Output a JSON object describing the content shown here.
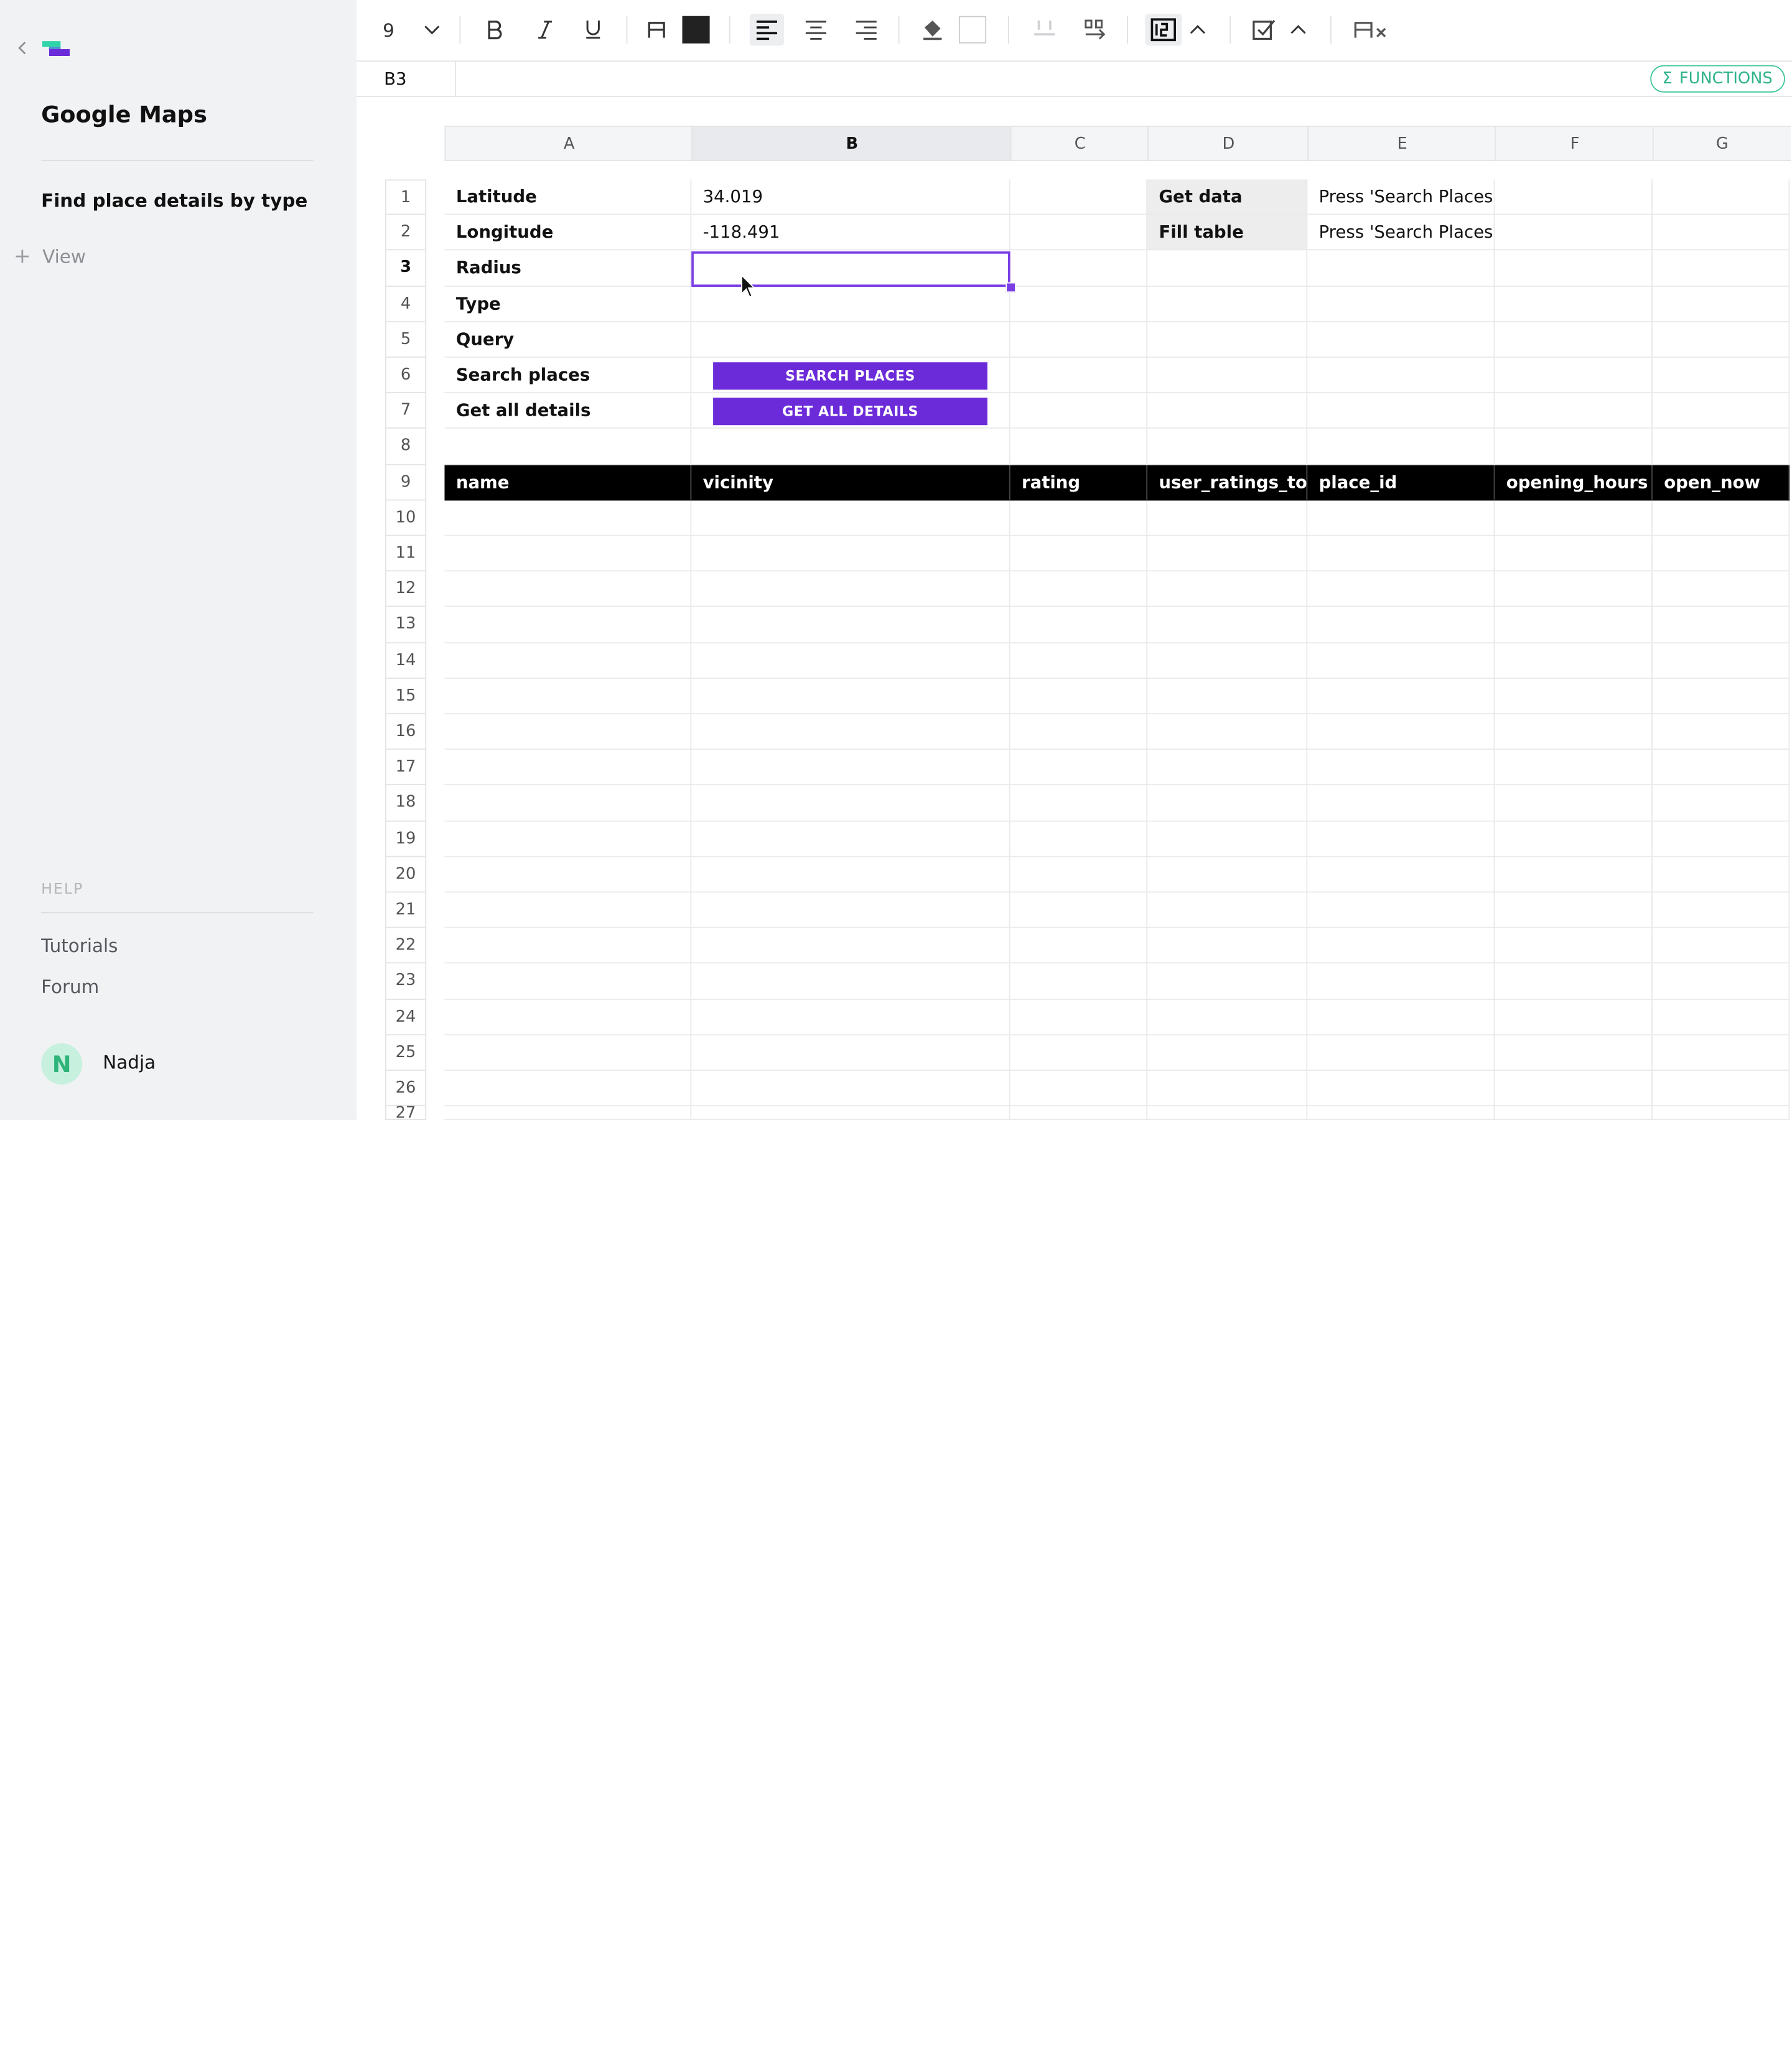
{
  "sidebar": {
    "app_title": "Google Maps",
    "page_link": "Find place details by type",
    "add_view": "View",
    "help_label": "HELP",
    "links": [
      "Tutorials",
      "Forum"
    ],
    "user": {
      "initial": "N",
      "name": "Nadja"
    }
  },
  "toolbar": {
    "font_size": "9",
    "icons": [
      "chevron-down",
      "bold",
      "italic",
      "underline",
      "text-color",
      "align-left",
      "align-center",
      "align-right",
      "fill-color",
      "column-width",
      "transpose",
      "number-format",
      "checkbox-format",
      "clear-format"
    ]
  },
  "formula_bar": {
    "cell_ref": "B3",
    "functions_label": "FUNCTIONS"
  },
  "grid": {
    "columns": [
      "A",
      "B",
      "C",
      "D",
      "E",
      "F",
      "G"
    ],
    "selected_column": "B",
    "rows": [
      "1",
      "2",
      "3",
      "4",
      "5",
      "6",
      "7",
      "8",
      "9",
      "10",
      "11",
      "12",
      "13",
      "14",
      "15",
      "16",
      "17",
      "18",
      "19",
      "20",
      "21",
      "22",
      "23",
      "24",
      "25",
      "26",
      "27"
    ],
    "selected_row": "3",
    "labels": [
      "Latitude",
      "Longitude",
      "Radius",
      "Type",
      "Query",
      "Search places",
      "Get all details"
    ],
    "values": {
      "latitude": "34.019",
      "longitude": "-118.491",
      "radius": "",
      "type": "",
      "query": ""
    },
    "buttons": {
      "search": "SEARCH PLACES",
      "details": "GET ALL DETAILS"
    },
    "info": [
      {
        "label": "Get data",
        "value": "Press 'Search Places'"
      },
      {
        "label": "Fill table",
        "value": "Press 'Search Places'"
      }
    ],
    "table_headers": [
      "name",
      "vicinity",
      "rating",
      "user_ratings_to...",
      "place_id",
      "opening_hours",
      "open_now"
    ]
  },
  "colors": {
    "accent": "#6c2bd9",
    "functions": "#2fb28b",
    "header_bg": "#000000"
  }
}
